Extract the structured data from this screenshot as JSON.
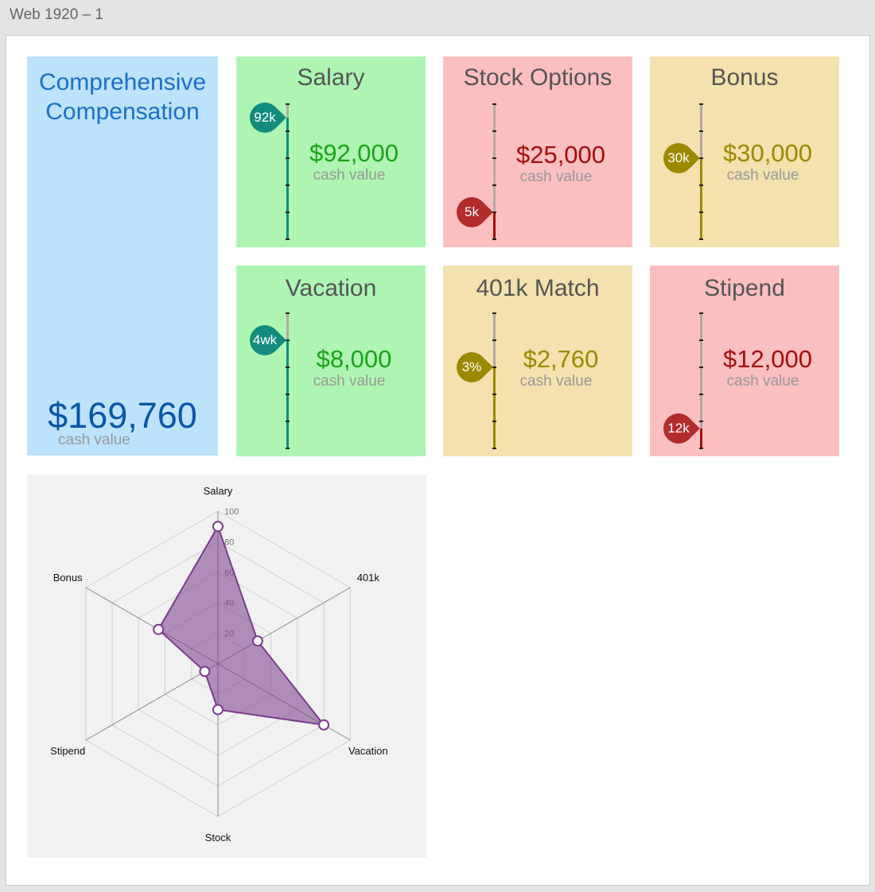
{
  "window": {
    "title": "Web 1920 – 1"
  },
  "summary": {
    "title_line1": "Comprehensive",
    "title_line2": "Compensation",
    "total": "$169,760",
    "sub": "cash value"
  },
  "cards": [
    {
      "title": "Salary",
      "amount": "$92,000",
      "sub": "cash value",
      "pin": "92k",
      "level": 0.9,
      "theme": "green"
    },
    {
      "title": "Stock Options",
      "amount": "$25,000",
      "sub": "cash value",
      "pin": "5k",
      "level": 0.2,
      "theme": "red"
    },
    {
      "title": "Bonus",
      "amount": "$30,000",
      "sub": "cash value",
      "pin": "30k",
      "level": 0.6,
      "theme": "yellow"
    },
    {
      "title": "Vacation",
      "amount": "$8,000",
      "sub": "cash value",
      "pin": "4wk",
      "level": 0.8,
      "theme": "green"
    },
    {
      "title": "401k Match",
      "amount": "$2,760",
      "sub": "cash value",
      "pin": "3%",
      "level": 0.6,
      "theme": "yellow"
    },
    {
      "title": "Stipend",
      "amount": "$12,000",
      "sub": "cash value",
      "pin": "12k",
      "level": 0.15,
      "theme": "red"
    }
  ],
  "themes": {
    "green": {
      "bg": "#aef5b3",
      "amount": "#19a319",
      "pin": "#138c7e",
      "fill": "#138c7e"
    },
    "red": {
      "bg": "#fbbfc0",
      "amount": "#a50d0d",
      "pin": "#b22c2c",
      "fill": "#a50d0d"
    },
    "yellow": {
      "bg": "#f3e1ae",
      "amount": "#9a8a00",
      "pin": "#9a8a00",
      "fill": "#9a8a00"
    }
  },
  "chart_data": {
    "type": "radar",
    "categories": [
      "Salary",
      "401k",
      "Vacation",
      "Stock",
      "Stipend",
      "Bonus"
    ],
    "values": [
      90,
      30,
      80,
      30,
      10,
      45
    ],
    "rlim": [
      0,
      100
    ],
    "ticks": [
      "20",
      "40",
      "60",
      "80",
      "100"
    ],
    "color": "#7b3a8c"
  }
}
